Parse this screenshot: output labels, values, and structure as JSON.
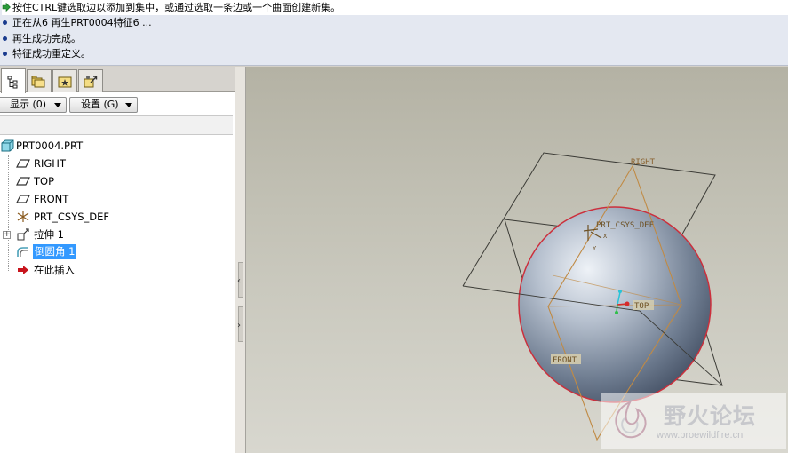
{
  "messages": [
    {
      "text": "按住CTRL键选取边以添加到集中，或通过选取一条边或一个曲面创建新集。",
      "marker": "arrow-icon"
    },
    {
      "text": "正在从6 再生PRT0004特征6 ...",
      "marker": "bullet"
    },
    {
      "text": "再生成功完成。",
      "marker": "bullet"
    },
    {
      "text": "特征成功重定义。",
      "marker": "bullet"
    }
  ],
  "tabs": [
    {
      "name": "model-tree-tab",
      "icon": "model-tree-icon"
    },
    {
      "name": "folder-browser-tab",
      "icon": "folder-icon"
    },
    {
      "name": "favorites-tab",
      "icon": "favorites-icon"
    },
    {
      "name": "connections-tab",
      "icon": "connections-icon"
    }
  ],
  "toolbar": {
    "show_label": "显示 (0)",
    "settings_label": "设置 (G)"
  },
  "tree": {
    "root": "PRT0004.PRT",
    "items": [
      {
        "label": "RIGHT",
        "icon": "datum-plane-icon"
      },
      {
        "label": "TOP",
        "icon": "datum-plane-icon"
      },
      {
        "label": "FRONT",
        "icon": "datum-plane-icon"
      },
      {
        "label": "PRT_CSYS_DEF",
        "icon": "coordinate-system-icon"
      },
      {
        "label": "拉伸 1",
        "icon": "extrude-icon"
      },
      {
        "label": "倒圆角 1",
        "icon": "round-icon",
        "selected": true
      },
      {
        "label": "在此插入",
        "icon": "insert-here-arrow-icon"
      }
    ]
  },
  "viewport": {
    "labels": {
      "right": "RIGHT",
      "top": "TOP",
      "front": "FRONT",
      "csys": "PRT_CSYS_DEF",
      "csys_x": "X",
      "csys_y": "Y"
    }
  },
  "watermark": {
    "title": "野火论坛",
    "url": "www.proewildfire.cn"
  },
  "colors": {
    "message_bg": "#e4e8f1",
    "selection": "#3399ff",
    "datum_plane": "#c8964a",
    "sphere_edge": "#c8323c"
  }
}
